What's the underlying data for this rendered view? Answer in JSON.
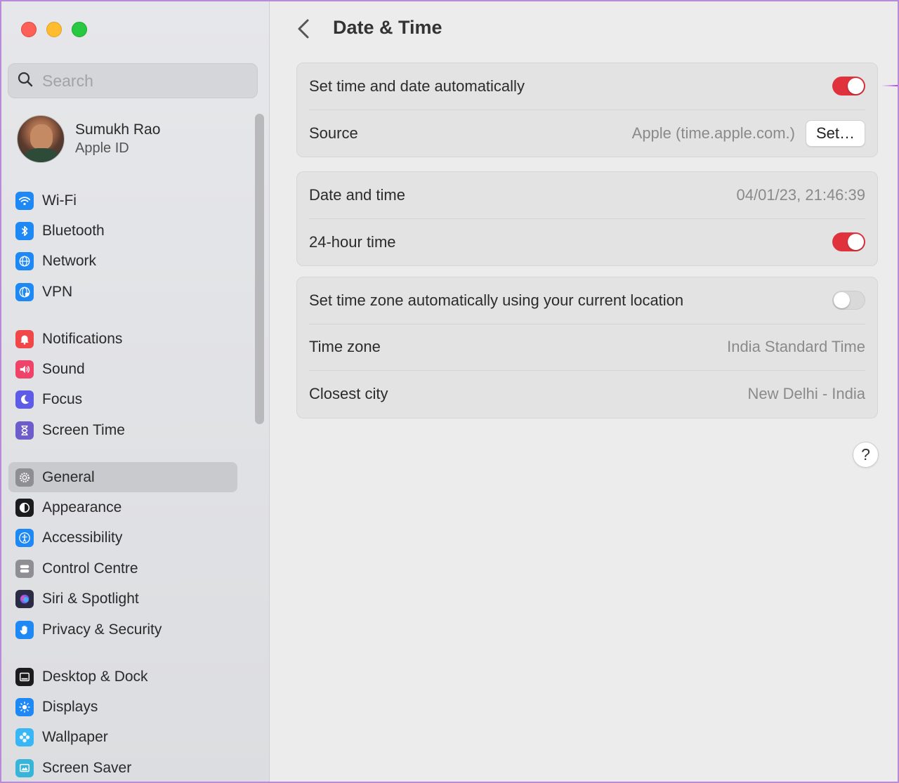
{
  "window": {
    "traffic_lights": [
      "close",
      "minimize",
      "zoom"
    ]
  },
  "sidebar": {
    "search_placeholder": "Search",
    "profile": {
      "name": "Sumukh Rao",
      "subtitle": "Apple ID"
    },
    "groups": [
      [
        {
          "label": "Wi-Fi",
          "icon": "wifi-icon",
          "color": "#1e88f5"
        },
        {
          "label": "Bluetooth",
          "icon": "bluetooth-icon",
          "color": "#1e88f5"
        },
        {
          "label": "Network",
          "icon": "globe-icon",
          "color": "#1e88f5"
        },
        {
          "label": "VPN",
          "icon": "vpn-globe-icon",
          "color": "#1e88f5"
        }
      ],
      [
        {
          "label": "Notifications",
          "icon": "bell-icon",
          "color": "#f04848"
        },
        {
          "label": "Sound",
          "icon": "speaker-icon",
          "color": "#f0436a"
        },
        {
          "label": "Focus",
          "icon": "moon-icon",
          "color": "#5e5ce6"
        },
        {
          "label": "Screen Time",
          "icon": "hourglass-icon",
          "color": "#6f5ccb"
        }
      ],
      [
        {
          "label": "General",
          "icon": "gear-icon",
          "color": "#8e8e93",
          "selected": true
        },
        {
          "label": "Appearance",
          "icon": "appearance-icon",
          "color": "#1c1c1e"
        },
        {
          "label": "Accessibility",
          "icon": "accessibility-icon",
          "color": "#1e88f5"
        },
        {
          "label": "Control Centre",
          "icon": "control-centre-icon",
          "color": "#8e8e93"
        },
        {
          "label": "Siri & Spotlight",
          "icon": "siri-icon",
          "color": "#2b2b44"
        },
        {
          "label": "Privacy & Security",
          "icon": "hand-icon",
          "color": "#1e88f5"
        }
      ],
      [
        {
          "label": "Desktop & Dock",
          "icon": "dock-icon",
          "color": "#1c1c1e"
        },
        {
          "label": "Displays",
          "icon": "sun-icon",
          "color": "#1e88f5"
        },
        {
          "label": "Wallpaper",
          "icon": "flower-icon",
          "color": "#38b6f5"
        },
        {
          "label": "Screen Saver",
          "icon": "screen-saver-icon",
          "color": "#36b5d8"
        }
      ]
    ]
  },
  "main": {
    "title": "Date & Time",
    "group1": {
      "auto_label": "Set time and date automatically",
      "auto_on": true,
      "source_label": "Source",
      "source_value": "Apple (time.apple.com.)",
      "set_button": "Set…"
    },
    "group2": {
      "datetime_label": "Date and time",
      "datetime_value": "04/01/23, 21:46:39",
      "hour24_label": "24-hour time",
      "hour24_on": true
    },
    "group3": {
      "tz_auto_label": "Set time zone automatically using your current location",
      "tz_auto_on": false,
      "tz_label": "Time zone",
      "tz_value": "India Standard Time",
      "city_label": "Closest city",
      "city_value": "New Delhi - India"
    },
    "help": "?",
    "annotation_arrow_color": "#b040f5",
    "toggle_on_color": "#e0323d"
  }
}
